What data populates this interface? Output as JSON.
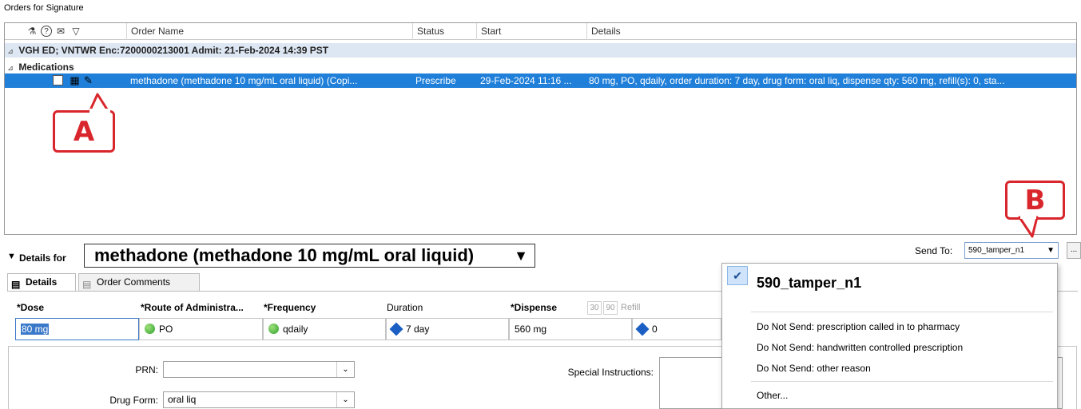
{
  "section_title": "Orders for Signature",
  "grid": {
    "header_icons": [
      "pill-stamp-icon",
      "help-circle-icon",
      "comment-icon",
      "filter-icon"
    ],
    "header_glyphs": [
      "⚗",
      "?",
      "✉",
      "▽"
    ],
    "columns": [
      "Order Name",
      "Status",
      "Start",
      "Details"
    ],
    "encounter_row": "VGH ED; VNTWR Enc:7200000213001  Admit: 21-Feb-2024 14:39 PST",
    "group_label": "Medications",
    "collapse_glyph": "⊿",
    "order": {
      "name": "methadone (methadone 10 mg/mL oral liquid) (Copi...",
      "status": "Prescribe",
      "start": "29-Feb-2024 11:16 ...",
      "details": "80 mg, PO, qdaily, order duration: 7 day, drug form: oral liq, dispense qty: 560 mg, refill(s): 0, sta..."
    }
  },
  "callouts": {
    "a": "A",
    "b": "B"
  },
  "details": {
    "label": "Details for",
    "order_title": "methadone (methadone 10 mg/mL oral liquid)",
    "sendto_label": "Send To:",
    "sendto_value": "590_tamper_n1",
    "ellipsis": "...",
    "tabs": [
      "Details",
      "Order Comments"
    ],
    "fields": {
      "dose_label": "*Dose",
      "route_label": "*Route of Administra...",
      "frequency_label": "*Frequency",
      "duration_label": "Duration",
      "dispense_label": "*Dispense",
      "btn_30": "30",
      "btn_90": "90",
      "refill_label": "Refill",
      "dose_value": "80 mg",
      "route_value": "PO",
      "frequency_value": "qdaily",
      "duration_value": "7 day",
      "dispense_value": "560 mg",
      "refill_value": "0"
    },
    "lower": {
      "prn_label": "PRN:",
      "prn_value": "",
      "drug_form_label": "Drug Form:",
      "drug_form_value": "oral liq",
      "special_instructions_label": "Special Instructions:"
    }
  },
  "popup": {
    "selected": "590_tamper_n1",
    "options": [
      "Do Not Send: prescription called in to pharmacy",
      "Do Not Send: handwritten controlled prescription",
      "Do Not Send: other reason",
      "Other..."
    ]
  },
  "colors": {
    "selection_blue": "#1f7fd9",
    "callout_red": "#d9262c",
    "encounter_row_bg": "#dde7f3",
    "status_green": "#2ea12e",
    "diamond_blue": "#1c5fc4"
  }
}
